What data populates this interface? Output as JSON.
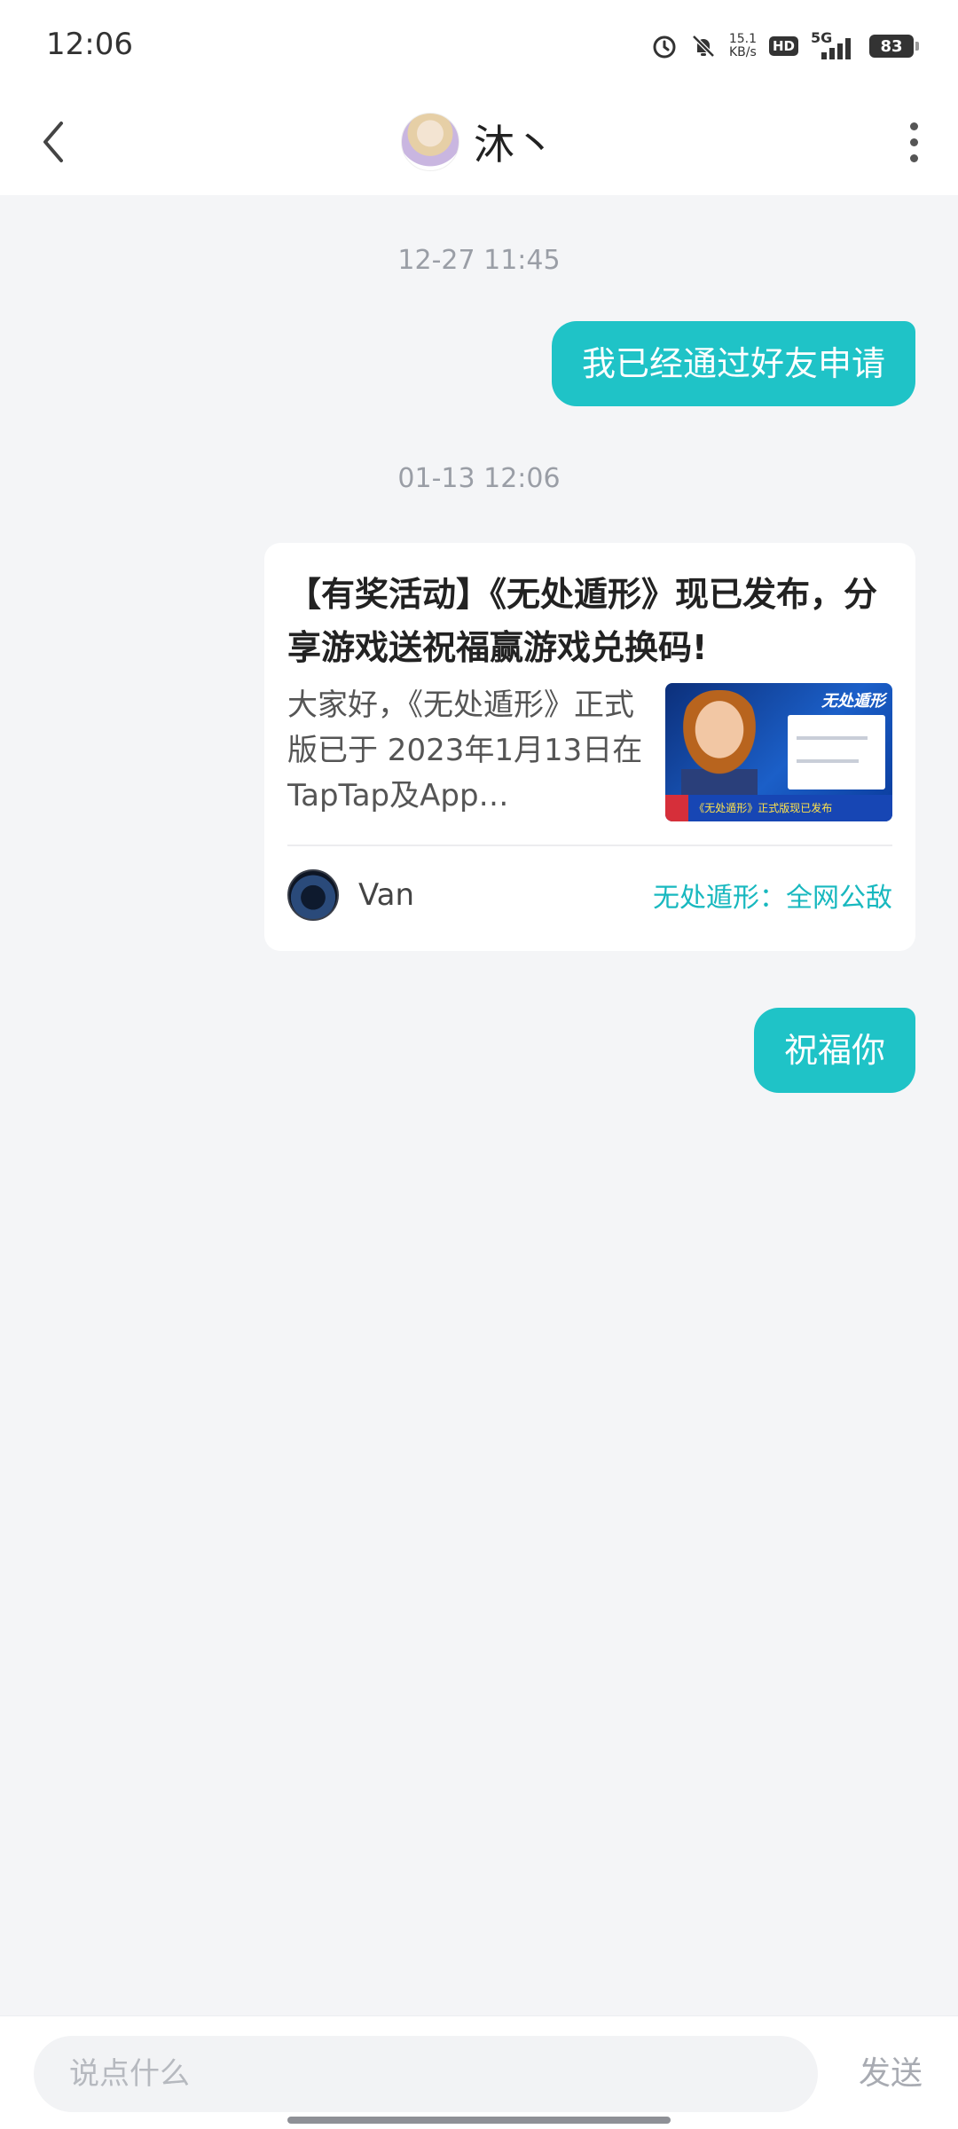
{
  "status_bar": {
    "time": "12:06",
    "net_speed_value": "15.1",
    "net_speed_unit": "KB/s",
    "hd_label": "HD",
    "network": "5G",
    "battery": "83"
  },
  "header": {
    "contact_name": "沐丶"
  },
  "messages": [
    {
      "timestamp": "12-27 11:45",
      "text": "我已经通过好友申请"
    },
    {
      "timestamp": "01-13 12:06"
    }
  ],
  "share_card": {
    "title": "【有奖活动】《无处遁形》现已发布，分享游戏送祝福赢游戏兑换码!",
    "description": "大家好，《无处遁形》正式版已于 2023年1月13日在TapTap及App…",
    "thumbnail_tag": "无处遁形",
    "thumbnail_banner": "《无处遁形》正式版现已发布",
    "author": "Van",
    "game_name": "无处遁形：全网公敌"
  },
  "reply_message": "祝福你",
  "input": {
    "placeholder": "说点什么",
    "send_label": "发送"
  }
}
